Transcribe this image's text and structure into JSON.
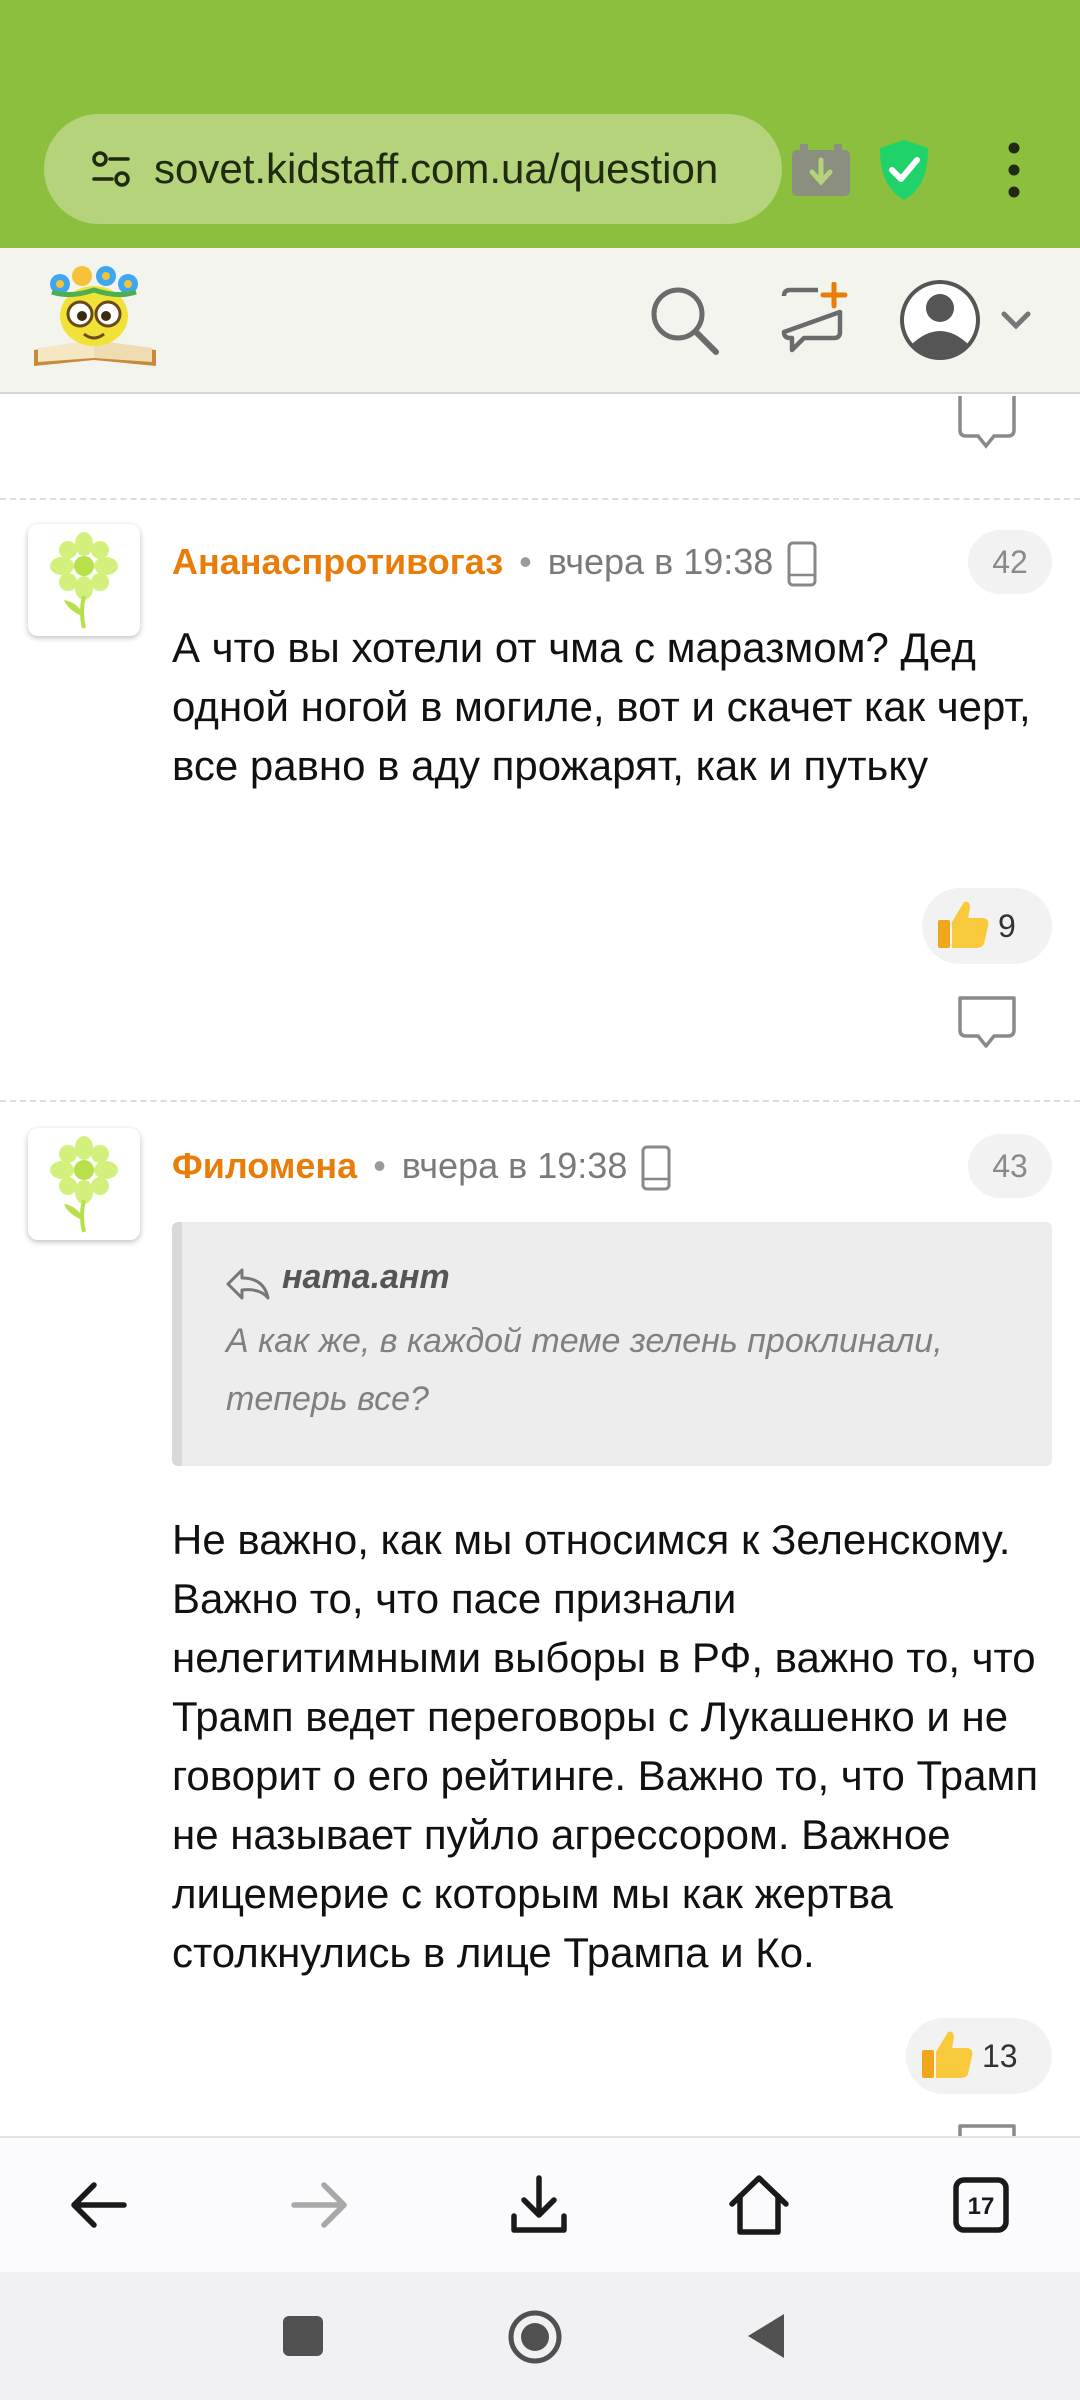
{
  "browser": {
    "url": "sovet.kidstaff.com.ua/question",
    "tab_count": "17",
    "icons": [
      "site-settings-icon",
      "download-extension-icon",
      "adguard-shield-icon",
      "overflow-menu-icon"
    ]
  },
  "site_header": {
    "logo": "kidstaff-logo",
    "icons": [
      "search-icon",
      "new-question-icon",
      "user-avatar-icon",
      "chevron-down-icon"
    ]
  },
  "comments": [
    {
      "author": "Ананаспротивогаз",
      "separator": "•",
      "time": "вчера в 19:38",
      "number": "42",
      "text": "А что вы хотели от чма с маразмом? Дед одной ногой в могиле, вот и скачет как черт, все равно в аду прожарят, как и путьку",
      "likes": "9"
    },
    {
      "author": "Филомена",
      "separator": "•",
      "time": "вчера в 19:38",
      "number": "43",
      "quote": {
        "author": "ната.ант",
        "text": "А как же, в каждой теме зелень проклинали, теперь все?"
      },
      "text": "Не важно, как мы относимся к Зеленскому. Важно то, что пасе признали нелегитимными выборы в РФ, важно то, что Трамп ведет переговоры с Лукашенко и не говорит о его рейтинге. Важно то, что Трамп не называет пуйло агрессором. Важное лицемерие с которым мы как жертва столкнулись в лице Трампа и Ко.",
      "likes": "13"
    }
  ],
  "colors": {
    "chrome_green": "#8dbf3e",
    "author_orange": "#e87d0a",
    "shield_green": "#1fd26a"
  }
}
